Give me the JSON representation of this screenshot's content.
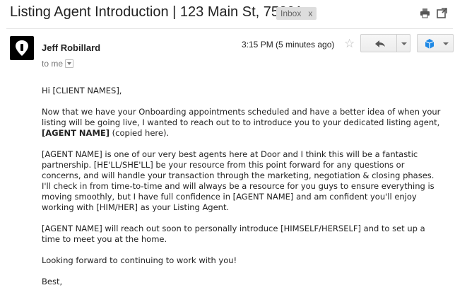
{
  "subject": "Listing Agent Introduction | 123 Main St, 75201",
  "label": {
    "text": "Inbox",
    "remove": "x"
  },
  "icons": {
    "print": "print-icon",
    "open_new_window": "new-window-icon",
    "star": "star-icon",
    "reply": "reply-icon",
    "more": "chevron-down-icon",
    "extension": "cube-icon",
    "avatar": "door-logo-icon"
  },
  "message": {
    "sender": "Jeff Robillard",
    "recipient": "to me",
    "timestamp": "3:15 PM (5 minutes ago)"
  },
  "body": {
    "greeting": "Hi [CLIENT NAMES],",
    "p1_text": "Now that we have your Onboarding appointments scheduled and have a better idea of when your listing will be going live, I wanted to reach out to to introduce you to your dedicated listing agent, ",
    "p1_agent": "[AGENT NAME]",
    "p1_end": " (copied here).",
    "p2": "[AGENT NAME] is one of our very best agents here at Door and I think this will be a fantastic partnership. [HE'LL/SHE'LL] be your resource from this point forward for any questions or concerns, and will handle your transaction through the marketing, negotiation & closing phases. I'll check in from time-to-time and will always be a resource for you guys to ensure everything is moving smoothly, but I have full confidence in [AGENT NAME] and am confident you'll enjoy working with [HIM/HER] as your Listing Agent.",
    "p3": "[AGENT NAME] will reach out soon to personally introduce [HIMSELF/HERSELF] and to set up a time to meet you at the home.",
    "p4": "Looking forward to continuing to work with you!",
    "closing": "Best,"
  }
}
